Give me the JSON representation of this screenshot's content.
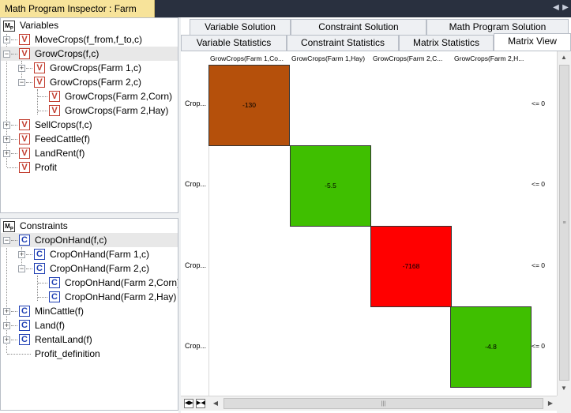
{
  "window": {
    "title": "Math Program Inspector : Farm"
  },
  "variables": {
    "header": "Variables",
    "items": [
      "MoveCrops(f_from,f_to,c)",
      "GrowCrops(f,c)",
      "GrowCrops(Farm 1,c)",
      "GrowCrops(Farm 2,c)",
      "GrowCrops(Farm 2,Corn)",
      "GrowCrops(Farm 2,Hay)",
      "SellCrops(f,c)",
      "FeedCattle(f)",
      "LandRent(f)",
      "Profit"
    ]
  },
  "constraints": {
    "header": "Constraints",
    "items": [
      "CropOnHand(f,c)",
      "CropOnHand(Farm 1,c)",
      "CropOnHand(Farm 2,c)",
      "CropOnHand(Farm 2,Corn)",
      "CropOnHand(Farm 2,Hay)",
      "MinCattle(f)",
      "Land(f)",
      "RentalLand(f)",
      "Profit_definition"
    ]
  },
  "tabs": {
    "row1": [
      "Variable Solution",
      "Constraint Solution",
      "Math Program Solution"
    ],
    "row2": [
      "Variable Statistics",
      "Constraint Statistics",
      "Matrix Statistics",
      "Matrix View"
    ],
    "active": "Matrix View"
  },
  "matrix": {
    "columns": [
      "GrowCrops(Farm 1,Co...",
      "GrowCrops(Farm 1,Hay)",
      "GrowCrops(Farm 2,C...",
      "GrowCrops(Farm 2,H..."
    ],
    "rows": [
      "Crop...",
      "Crop...",
      "Crop...",
      "Crop..."
    ],
    "relations": [
      "<= 0",
      "<= 0",
      "<= 0",
      "<= 0"
    ],
    "values": [
      "-130",
      "-5.5",
      "-7168",
      "-4.8"
    ],
    "colors": [
      "#b5500b",
      "#3fbf00",
      "#ff0000",
      "#3fbf00"
    ]
  },
  "scroll_icons": {
    "up": "scroll-up-icon",
    "down": "scroll-down-icon",
    "left": "scroll-left-icon",
    "right": "scroll-right-icon"
  }
}
